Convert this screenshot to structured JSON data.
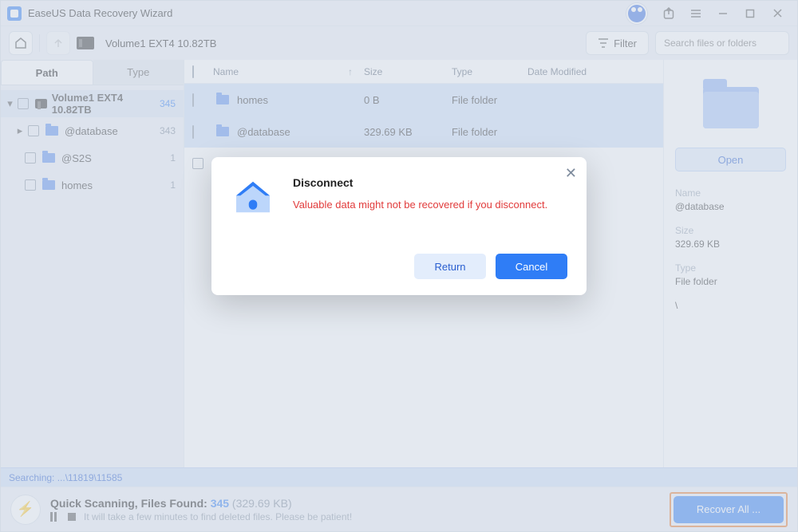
{
  "app": {
    "title": "EaseUS Data Recovery Wizard"
  },
  "toolbar": {
    "location": "Volume1 EXT4  10.82TB",
    "filter_label": "Filter",
    "search_placeholder": "Search files or folders"
  },
  "sidebar": {
    "tabs": {
      "path": "Path",
      "type": "Type"
    },
    "root": {
      "label": "Volume1 EXT4  10.82TB",
      "count": "345"
    },
    "children": [
      {
        "label": "@database",
        "count": "343"
      },
      {
        "label": "@S2S",
        "count": "1"
      },
      {
        "label": "homes",
        "count": "1"
      }
    ]
  },
  "columns": {
    "name": "Name",
    "size": "Size",
    "type": "Type",
    "date": "Date Modified"
  },
  "rows": [
    {
      "name": "homes",
      "size": "0 B",
      "type": "File folder"
    },
    {
      "name": "@database",
      "size": "329.69 KB",
      "type": "File folder"
    }
  ],
  "details": {
    "open": "Open",
    "name_label": "Name",
    "name_value": "@database",
    "size_label": "Size",
    "size_value": "329.69 KB",
    "type_label": "Type",
    "type_value": "File folder",
    "path_value": "\\"
  },
  "status": {
    "text": "Searching: ...\\11819\\11585"
  },
  "footer": {
    "scan_prefix": "Quick Scanning, Files Found: ",
    "scan_count": "345",
    "scan_size": " (329.69 KB)",
    "hint": "It will take a few minutes to find deleted files. Please be patient!",
    "recover": "Recover All ..."
  },
  "modal": {
    "title": "Disconnect",
    "message": "Valuable data might not be recovered if you disconnect.",
    "return": "Return",
    "cancel": "Cancel"
  }
}
